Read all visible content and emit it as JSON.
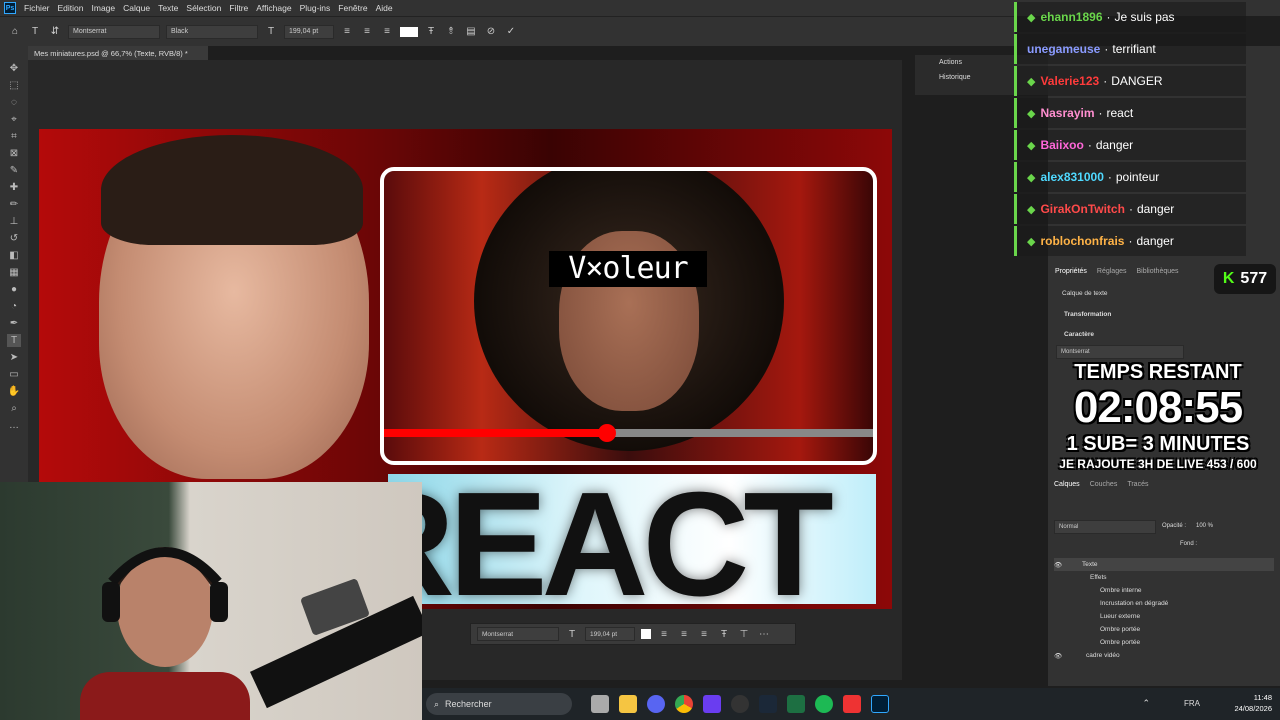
{
  "menubar": {
    "items": [
      "Fichier",
      "Edition",
      "Image",
      "Calque",
      "Texte",
      "Sélection",
      "Filtre",
      "Affichage",
      "Plug-ins",
      "Fenêtre",
      "Aide"
    ]
  },
  "options": {
    "font": "Montserrat",
    "style": "Black",
    "size": "199,04 pt"
  },
  "doc": {
    "tab": "Mes miniatures.psd @ 66,7% (Texte, RVB/8) *"
  },
  "thumbnail": {
    "blurred_name": "V×oleur",
    "big_text": "REACT",
    "video_progress": 0.45
  },
  "floatbar": {
    "font": "Montserrat",
    "size": "199,04 pt"
  },
  "actions": {
    "a": "Actions",
    "b": "Historique"
  },
  "chat": [
    {
      "user": "ehann1896",
      "msg": "Je suis pas",
      "color": "#6ad64b"
    },
    {
      "user": "unegameuse",
      "msg": "terrifiant",
      "color": "#8a9bff"
    },
    {
      "user": "Valerie123",
      "msg": "DANGER",
      "color": "#ff3b3b"
    },
    {
      "user": "Nasrayim",
      "msg": "react",
      "color": "#ff8fd0"
    },
    {
      "user": "Baiixoo",
      "msg": "danger",
      "color": "#ff67d9"
    },
    {
      "user": "alex831000",
      "msg": "pointeur",
      "color": "#4fd9ff"
    },
    {
      "user": "GirakOnTwitch",
      "msg": "danger",
      "color": "#ff4a4a"
    },
    {
      "user": "roblochonfrais",
      "msg": "danger",
      "color": "#ffb347"
    }
  ],
  "kick": {
    "viewers": "577"
  },
  "timer": {
    "l1": "TEMPS RESTANT",
    "l2": "02:08:55",
    "l3": "1 SUB= 3 MINUTES",
    "l4": "JE RAJOUTE 3H DE LIVE 453 / 600"
  },
  "props": {
    "tab1": "Propriétés",
    "tab2": "Réglages",
    "tab3": "Bibliothèques",
    "layer_type": "Calque de texte",
    "transform": "Transformation",
    "caractere": "Caractère",
    "font": "Montserrat"
  },
  "layers": {
    "tab1": "Calques",
    "tab2": "Couches",
    "tab3": "Tracés",
    "mode": "Normal",
    "opacity_label": "Opacité :",
    "opacity": "100 %",
    "fond_label": "Fond :",
    "items": [
      "Texte",
      "Effets",
      "Ombre interne",
      "Incrustation en dégradé",
      "Lueur externe",
      "Ombre portée",
      "Ombre portée",
      "cadre vidéo"
    ]
  },
  "taskbar": {
    "search": "Rechercher",
    "lang": "FRA",
    "time": "11:48",
    "date": "24/08/2026"
  }
}
